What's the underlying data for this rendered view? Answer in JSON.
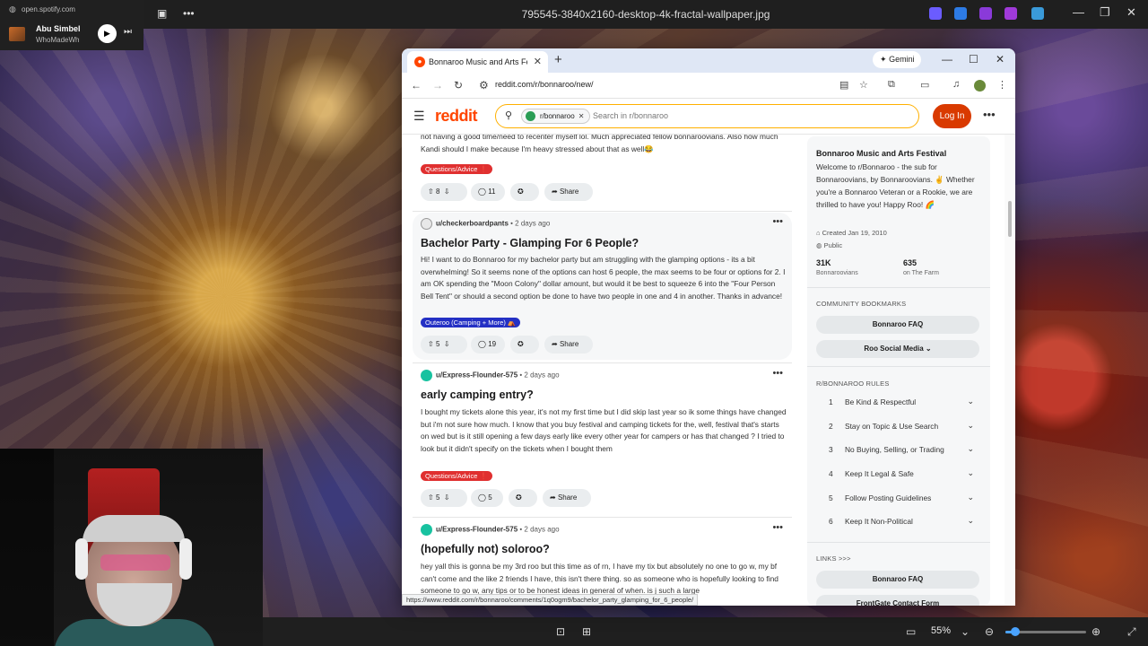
{
  "spotify": {
    "url": "open.spotify.com",
    "song": "Abu Simbel",
    "artist": "WhoMadeWho"
  },
  "viewer": {
    "title": "795545-3840x2160-desktop-4k-fractal-wallpaper.jpg",
    "zoom": "55%",
    "zoom_fraction": 0.12
  },
  "browser": {
    "tab_title": "Bonnaroo Music and Arts Festival",
    "gemini_label": "Gemini",
    "url": "reddit.com/r/bonnaroo/new/",
    "status_url": "https://www.reddit.com/r/bonnaroo/comments/1q0ogm9/bachelor_party_glamping_for_6_people/"
  },
  "reddit": {
    "logo": "reddit",
    "search_chip": "r/bonnaroo",
    "search_placeholder": "Search in r/bonnaroo",
    "login": "Log In"
  },
  "posts": [
    {
      "body": "not having a good time/need to recenter myself lol. Much appreciated fellow bonnaroovians. Also how much Kandi should I make because I'm heavy stressed about that as well😂",
      "flair": "Questions/Advice ❗",
      "votes": "8",
      "comments": "11",
      "share": "Share"
    },
    {
      "user": "u/checkerboardpants",
      "time": "• 2 days ago",
      "title": "Bachelor Party - Glamping For 6 People?",
      "body": "Hi! I want to do Bonnaroo for my bachelor party but am struggling with the glamping options - its a bit overwhelming! So it seems none of the options can host 6 people, the max seems to be four or options for 2. I am OK spending the \"Moon Colony\" dollar amount, but would it be best to squeeze 6 into the \"Four Person Bell Tent\" or should a second option be done to have two people in one and 4 in another. Thanks in advance!",
      "flair": "Outeroo (Camping + More) ⛺",
      "votes": "5",
      "comments": "19",
      "share": "Share"
    },
    {
      "user": "u/Express-Flounder-575",
      "time": "• 2 days ago",
      "title": "early camping entry?",
      "body": "I bought my tickets alone this year, it's not my first time but I did skip last year so ik some things have changed but i'm not sure how much. I know that you buy festival and camping tickets for the, well, festival that's starts on wed but is it still opening a few days early like every other year for campers or has that changed ? I tried to look but it didn't specify on the tickets when I bought them",
      "flair": "Questions/Advice ❗",
      "votes": "5",
      "comments": "5",
      "share": "Share"
    },
    {
      "user": "u/Express-Flounder-575",
      "time": "• 2 days ago",
      "title": "(hopefully not) soloroo?",
      "body": "hey yall this is gonna be my 3rd roo but this time as of rn, I have my tix but absolutely no one to go w, my bf can't come and the like 2 friends I have, this isn't there thing. so as someone who is hopefully looking to find someone to go w, any tips or to be honest ideas in general of when. is j such a large"
    }
  ],
  "sidebar": {
    "title": "Bonnaroo Music and Arts Festival",
    "description": "Welcome to r/Bonnaroo - the sub for Bonnaroovians, by Bonnaroovians. ✌️ Whether you're a Bonnaroo Veteran or a Rookie, we are thrilled to have you! Happy Roo! 🌈",
    "created": "Created Jan 19, 2010",
    "visibility": "Public",
    "members": "31K",
    "members_label": "Bonnaroovians",
    "online": "635",
    "online_label": "on The Farm",
    "bookmarks_heading": "COMMUNITY BOOKMARKS",
    "bookmark_faq": "Bonnaroo FAQ",
    "bookmark_social": "Roo Social Media",
    "rules_heading": "R/BONNAROO RULES",
    "rules": [
      {
        "num": "1",
        "text": "Be Kind & Respectful"
      },
      {
        "num": "2",
        "text": "Stay on Topic & Use Search"
      },
      {
        "num": "3",
        "text": "No Buying, Selling, or Trading"
      },
      {
        "num": "4",
        "text": "Keep It Legal & Safe"
      },
      {
        "num": "5",
        "text": "Follow Posting Guidelines"
      },
      {
        "num": "6",
        "text": "Keep It Non-Political"
      }
    ],
    "links_heading": "LINKS >>>",
    "links_faq": "Bonnaroo FAQ",
    "links_frontgate": "FrontGate Contact Form"
  }
}
